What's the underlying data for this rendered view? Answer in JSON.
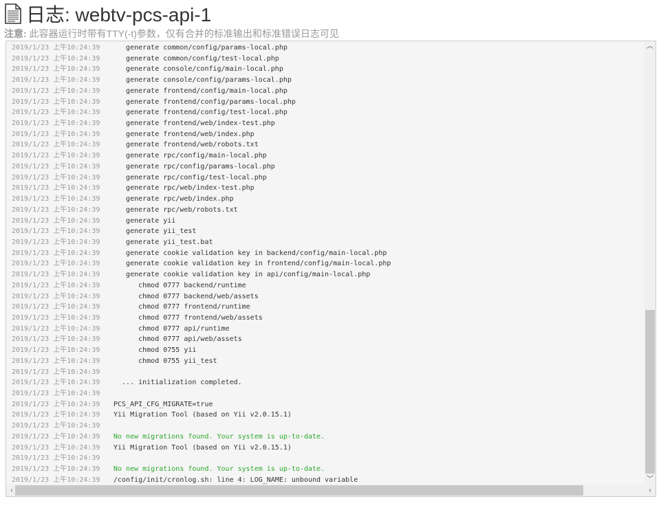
{
  "header": {
    "title": "日志: webtv-pcs-api-1",
    "note_label": "注意:",
    "note_text": " 此容器运行时带有TTY(-t)参数，仅有合并的标准输出和标准错误日志可见",
    "icon": "document-icon"
  },
  "colors": {
    "success": "#2ea82e",
    "timestamp": "#999999"
  },
  "log": [
    {
      "time": "2019/1/23 上午10:24:39",
      "text": "   generate common/config/params-local.php"
    },
    {
      "time": "2019/1/23 上午10:24:39",
      "text": "   generate common/config/test-local.php"
    },
    {
      "time": "2019/1/23 上午10:24:39",
      "text": "   generate console/config/main-local.php"
    },
    {
      "time": "2019/1/23 上午10:24:39",
      "text": "   generate console/config/params-local.php"
    },
    {
      "time": "2019/1/23 上午10:24:39",
      "text": "   generate frontend/config/main-local.php"
    },
    {
      "time": "2019/1/23 上午10:24:39",
      "text": "   generate frontend/config/params-local.php"
    },
    {
      "time": "2019/1/23 上午10:24:39",
      "text": "   generate frontend/config/test-local.php"
    },
    {
      "time": "2019/1/23 上午10:24:39",
      "text": "   generate frontend/web/index-test.php"
    },
    {
      "time": "2019/1/23 上午10:24:39",
      "text": "   generate frontend/web/index.php"
    },
    {
      "time": "2019/1/23 上午10:24:39",
      "text": "   generate frontend/web/robots.txt"
    },
    {
      "time": "2019/1/23 上午10:24:39",
      "text": "   generate rpc/config/main-local.php"
    },
    {
      "time": "2019/1/23 上午10:24:39",
      "text": "   generate rpc/config/params-local.php"
    },
    {
      "time": "2019/1/23 上午10:24:39",
      "text": "   generate rpc/config/test-local.php"
    },
    {
      "time": "2019/1/23 上午10:24:39",
      "text": "   generate rpc/web/index-test.php"
    },
    {
      "time": "2019/1/23 上午10:24:39",
      "text": "   generate rpc/web/index.php"
    },
    {
      "time": "2019/1/23 上午10:24:39",
      "text": "   generate rpc/web/robots.txt"
    },
    {
      "time": "2019/1/23 上午10:24:39",
      "text": "   generate yii"
    },
    {
      "time": "2019/1/23 上午10:24:39",
      "text": "   generate yii_test"
    },
    {
      "time": "2019/1/23 上午10:24:39",
      "text": "   generate yii_test.bat"
    },
    {
      "time": "2019/1/23 上午10:24:39",
      "text": "   generate cookie validation key in backend/config/main-local.php"
    },
    {
      "time": "2019/1/23 上午10:24:39",
      "text": "   generate cookie validation key in frontend/config/main-local.php"
    },
    {
      "time": "2019/1/23 上午10:24:39",
      "text": "   generate cookie validation key in api/config/main-local.php"
    },
    {
      "time": "2019/1/23 上午10:24:39",
      "text": "      chmod 0777 backend/runtime"
    },
    {
      "time": "2019/1/23 上午10:24:39",
      "text": "      chmod 0777 backend/web/assets"
    },
    {
      "time": "2019/1/23 上午10:24:39",
      "text": "      chmod 0777 frontend/runtime"
    },
    {
      "time": "2019/1/23 上午10:24:39",
      "text": "      chmod 0777 frontend/web/assets"
    },
    {
      "time": "2019/1/23 上午10:24:39",
      "text": "      chmod 0777 api/runtime"
    },
    {
      "time": "2019/1/23 上午10:24:39",
      "text": "      chmod 0777 api/web/assets"
    },
    {
      "time": "2019/1/23 上午10:24:39",
      "text": "      chmod 0755 yii"
    },
    {
      "time": "2019/1/23 上午10:24:39",
      "text": "      chmod 0755 yii_test"
    },
    {
      "time": "2019/1/23 上午10:24:39",
      "text": ""
    },
    {
      "time": "2019/1/23 上午10:24:39",
      "text": "  ... initialization completed."
    },
    {
      "time": "2019/1/23 上午10:24:39",
      "text": ""
    },
    {
      "time": "2019/1/23 上午10:24:39",
      "text": "PCS_API_CFG_MIGRATE=true"
    },
    {
      "time": "2019/1/23 上午10:24:39",
      "text": "Yii Migration Tool (based on Yii v2.0.15.1)"
    },
    {
      "time": "2019/1/23 上午10:24:39",
      "text": ""
    },
    {
      "time": "2019/1/23 上午10:24:39",
      "text": "No new migrations found. Your system is up-to-date.",
      "green": true
    },
    {
      "time": "2019/1/23 上午10:24:39",
      "text": "Yii Migration Tool (based on Yii v2.0.15.1)"
    },
    {
      "time": "2019/1/23 上午10:24:39",
      "text": ""
    },
    {
      "time": "2019/1/23 上午10:24:39",
      "text": "No new migrations found. Your system is up-to-date.",
      "green": true
    },
    {
      "time": "2019/1/23 上午10:24:39",
      "text": "/config/init/cronlog.sh: line 4: LOG_NAME: unbound variable"
    }
  ]
}
